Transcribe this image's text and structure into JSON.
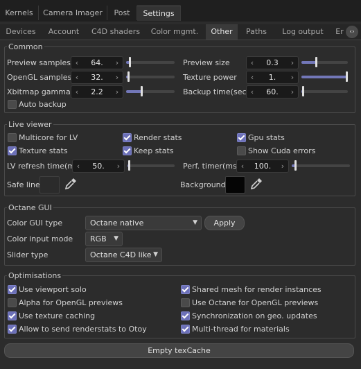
{
  "top_tabs": [
    {
      "label": "Kernels",
      "active": false
    },
    {
      "label": "Camera Imager",
      "active": false
    },
    {
      "label": "Post",
      "active": false
    },
    {
      "label": "Settings",
      "active": true
    }
  ],
  "sub_tabs": [
    {
      "label": "Devices",
      "active": false
    },
    {
      "label": "Account",
      "active": false
    },
    {
      "label": "C4D shaders",
      "active": false
    },
    {
      "label": "Color mgmt.",
      "active": false
    },
    {
      "label": "Other",
      "active": true
    },
    {
      "label": "Paths",
      "active": false
    },
    {
      "label": "Log output",
      "active": false
    },
    {
      "label": "Er",
      "active": false
    }
  ],
  "common": {
    "title": "Common",
    "preview_samples": {
      "label": "Preview samples",
      "value": "64.",
      "level": 0.06
    },
    "preview_size": {
      "label": "Preview size",
      "value": "0.3",
      "level": 0.3
    },
    "opengl_samples": {
      "label": "OpenGL samples",
      "value": "32.",
      "level": 0.03
    },
    "texture_power": {
      "label": "Texture power",
      "value": "1.",
      "level": 1.0
    },
    "xbitmap_gamma": {
      "label": "Xbitmap gamma",
      "value": "2.2",
      "level": 0.3
    },
    "backup_time": {
      "label": "Backup time(sec)",
      "value": "60.",
      "level": 0.01
    },
    "auto_backup": {
      "label": "Auto backup",
      "checked": false
    }
  },
  "live_viewer": {
    "title": "Live viewer",
    "multicore": {
      "label": "Multicore for LV",
      "checked": false
    },
    "render_stats": {
      "label": "Render stats",
      "checked": true
    },
    "gpu_stats": {
      "label": "Gpu stats",
      "checked": true
    },
    "texture_stats": {
      "label": "Texture stats",
      "checked": true
    },
    "keep_stats": {
      "label": "Keep stats",
      "checked": true
    },
    "cuda_errors": {
      "label": "Show Cuda errors",
      "checked": false
    },
    "lv_refresh": {
      "label": "LV refresh time(ms",
      "value": "50.",
      "level": 0.02
    },
    "perf_timer": {
      "label": "Perf. timer(ms)",
      "value": "100.",
      "level": 0.05
    },
    "safe_line": {
      "label": "Safe line",
      "color": "#2b2b2b"
    },
    "background": {
      "label": "Background",
      "color": "#050505"
    }
  },
  "octane_gui": {
    "title": "Octane GUI",
    "color_gui_type": {
      "label": "Color GUI type",
      "value": "Octane native"
    },
    "apply": "Apply",
    "color_input_mode": {
      "label": "Color input mode",
      "value": "RGB"
    },
    "slider_type": {
      "label": "Slider type",
      "value": "Octane C4D like"
    }
  },
  "optimisations": {
    "title": "Optimisations",
    "items": [
      {
        "label": "Use viewport solo",
        "checked": true
      },
      {
        "label": "Shared mesh for render instances",
        "checked": true
      },
      {
        "label": "Alpha for OpenGL previews",
        "checked": false
      },
      {
        "label": "Use Octane for OpenGL previews",
        "checked": false
      },
      {
        "label": "Use texture caching",
        "checked": true
      },
      {
        "label": "Synchronization on geo. updates",
        "checked": true
      },
      {
        "label": "Allow to send renderstats to Otoy",
        "checked": true
      },
      {
        "label": "Multi-thread for materials",
        "checked": true
      }
    ]
  },
  "empty_texcache": "Empty texCache",
  "colors": {
    "accent": "#6c70b8",
    "panel": "#2c2c2c"
  }
}
